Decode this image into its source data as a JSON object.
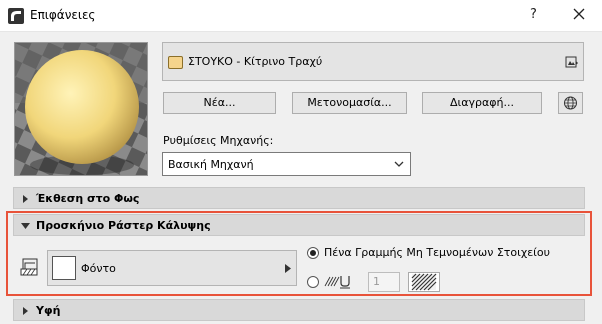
{
  "window": {
    "title": "Επιφάνειες",
    "help_label": "?"
  },
  "surface": {
    "name": "ΣΤΟΥΚΟ - Κίτρινο Τραχύ",
    "swatch_color": "#f5d48c"
  },
  "buttons": {
    "new": "Νέα...",
    "rename": "Μετονομασία...",
    "delete": "Διαγραφή..."
  },
  "engine": {
    "label": "Ρυθμίσεις Μηχανής:",
    "value": "Βασική Μηχανή"
  },
  "sections": {
    "exposure": "Έκθεση στο Φως",
    "raster": "Προσκήνιο Ράστερ Κάλυψης",
    "texture": "Υφή"
  },
  "raster": {
    "fill_name": "Φόντο",
    "pen_option_label": "Πένα Γραμμής Μη Τεμνομένων Στοιχείου",
    "pen_number": "1"
  },
  "colors": {
    "highlight": "#e8533a"
  }
}
